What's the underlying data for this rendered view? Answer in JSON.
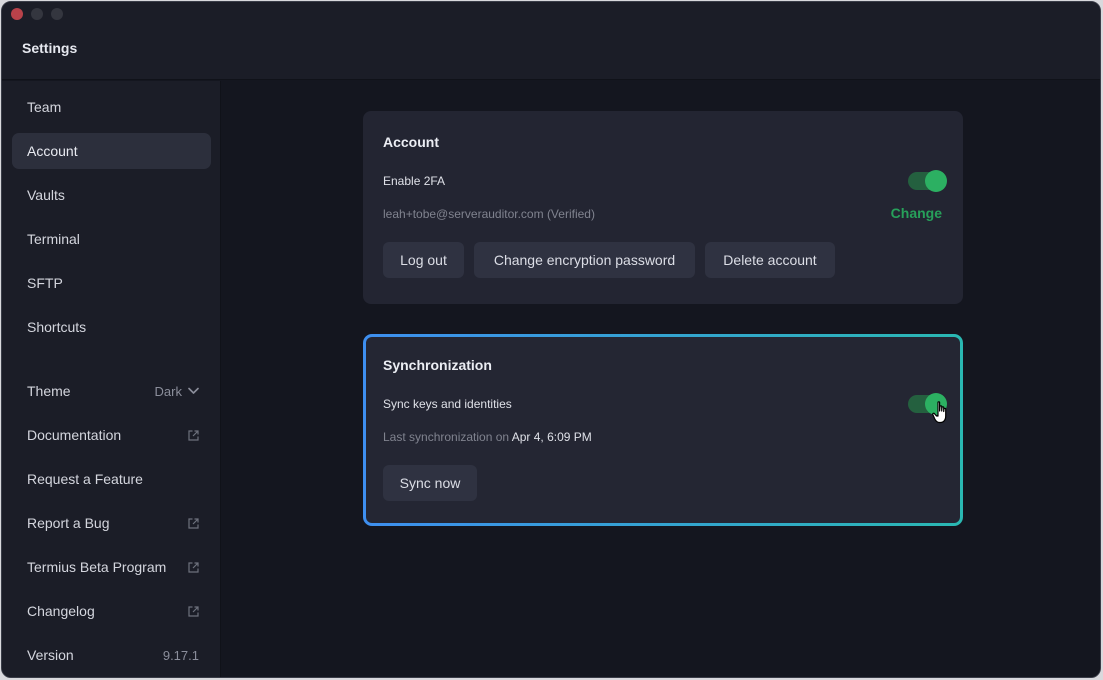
{
  "window": {
    "title": "Settings",
    "traffic_lights": [
      "close",
      "minimize",
      "zoom"
    ]
  },
  "sidebar": {
    "items": [
      {
        "label": "Team"
      },
      {
        "label": "Account",
        "active": true
      },
      {
        "label": "Vaults"
      },
      {
        "label": "Terminal"
      },
      {
        "label": "SFTP"
      },
      {
        "label": "Shortcuts"
      }
    ],
    "theme": {
      "label": "Theme",
      "value": "Dark",
      "icon": "chevron-down-icon"
    },
    "links": [
      {
        "label": "Documentation",
        "icon": "external-link-icon"
      },
      {
        "label": "Request a Feature"
      },
      {
        "label": "Report a Bug",
        "icon": "external-link-icon"
      },
      {
        "label": "Termius Beta Program",
        "icon": "external-link-icon"
      },
      {
        "label": "Changelog",
        "icon": "external-link-icon"
      }
    ],
    "version": {
      "label": "Version",
      "value": "9.17.1"
    }
  },
  "account": {
    "title": "Account",
    "enable_2fa_label": "Enable 2FA",
    "enable_2fa_on": true,
    "email": "leah+tobe@serverauditor.com (Verified)",
    "change_label": "Change",
    "buttons": {
      "logout": "Log out",
      "change_password": "Change encryption password",
      "delete": "Delete account"
    }
  },
  "sync": {
    "title": "Synchronization",
    "sync_keys_label": "Sync keys and identities",
    "sync_keys_on": true,
    "last_sync_prefix": "Last synchronization on",
    "last_sync_value": "Apr 4, 6:09 PM",
    "sync_now_label": "Sync now"
  },
  "colors": {
    "accent_green": "#27a05a",
    "toggle_track": "#24603f",
    "toggle_knob": "#2cb062",
    "sync_border_start": "#3e8ff0",
    "sync_border_end": "#2ab8b2",
    "close_button": "#b8424a"
  }
}
